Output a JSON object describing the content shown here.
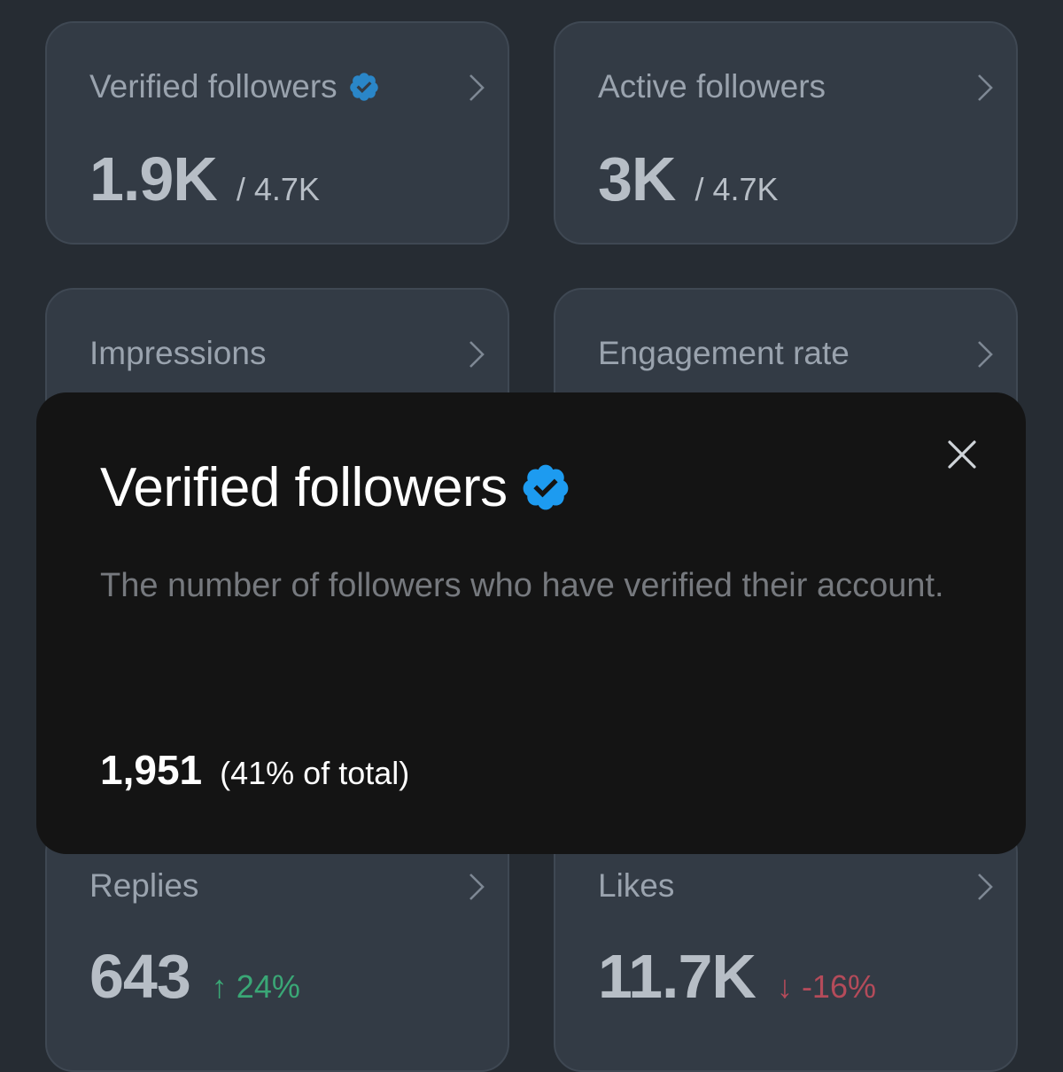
{
  "cards": {
    "verified": {
      "title": "Verified followers",
      "value": "1.9K",
      "total": "/ 4.7K"
    },
    "active": {
      "title": "Active followers",
      "value": "3K",
      "total": "/ 4.7K"
    },
    "impressions": {
      "title": "Impressions"
    },
    "engagement": {
      "title": "Engagement rate"
    },
    "replies": {
      "title": "Replies",
      "value": "643",
      "trend": "↑ 24%"
    },
    "likes": {
      "title": "Likes",
      "value": "11.7K",
      "trend": "↓ -16%"
    }
  },
  "modal": {
    "title": "Verified followers",
    "description": "The number of followers who have verified their account.",
    "count": "1,951",
    "percent": "(41% of total)"
  },
  "icons": {
    "verified": "verified-badge-icon",
    "chevron": "chevron-right-icon",
    "close": "close-icon"
  },
  "colors": {
    "verified_badge": "#1d9bf0",
    "trend_up": "#3aa776",
    "trend_down": "#b44b5a",
    "card_bg": "#333b45",
    "modal_bg": "#141414"
  }
}
